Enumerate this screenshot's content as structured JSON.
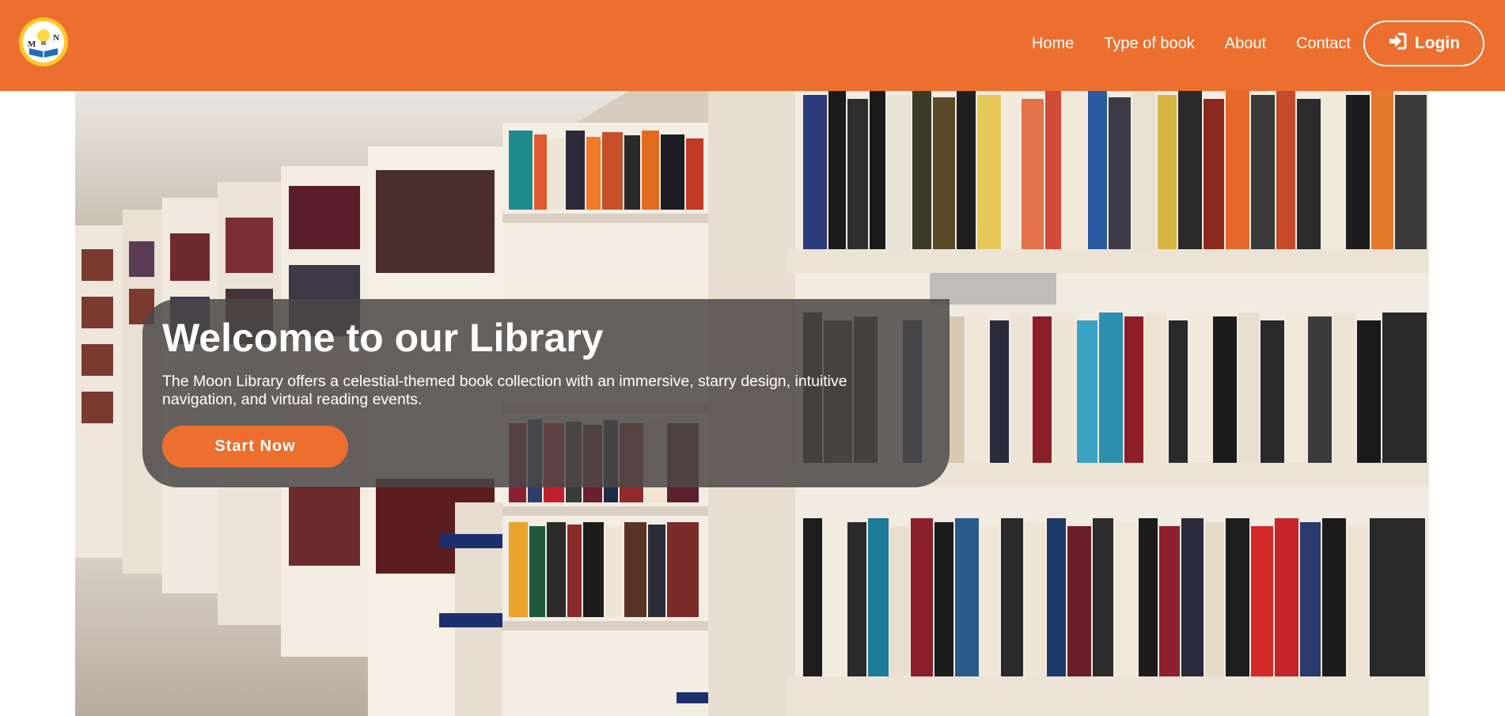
{
  "brand": {
    "logo_letters": [
      "M",
      "N"
    ],
    "logo_icon": "lightbulb-book-icon",
    "accent_color": "#ec6f2f",
    "logo_ring_color": "#ffc928"
  },
  "nav": {
    "items": [
      {
        "label": "Home"
      },
      {
        "label": "Type of book"
      },
      {
        "label": "About"
      },
      {
        "label": "Contact"
      }
    ],
    "login_label": "Login",
    "login_icon": "sign-in-icon"
  },
  "hero": {
    "background": "library-bookshelves-photo",
    "title": "Welcome to our Library",
    "description": "The Moon Library offers a celestial-themed book collection with an immersive, starry design, intuitive navigation, and virtual reading events.",
    "cta_label": "Start Now"
  }
}
